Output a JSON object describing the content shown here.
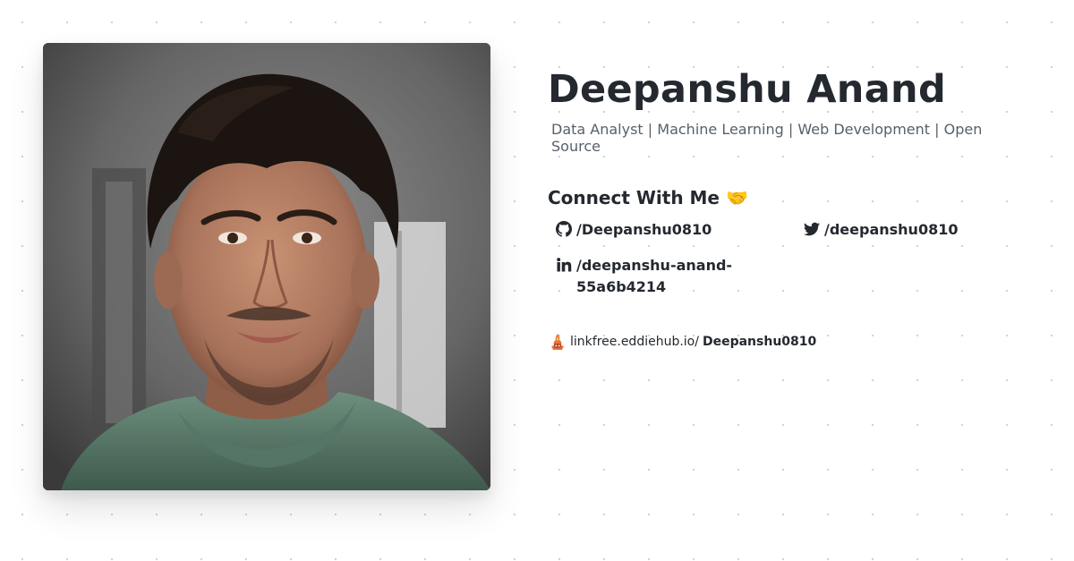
{
  "profile": {
    "name": "Deepanshu Anand",
    "tagline": "Data Analyst | Machine Learning | Web Development | Open Source",
    "connect_heading": "Connect With Me 🤝"
  },
  "socials": {
    "github": {
      "icon": "github-icon",
      "handle": "/Deepanshu0810"
    },
    "twitter": {
      "icon": "twitter-icon",
      "handle": "/deepanshu0810"
    },
    "linkedin": {
      "icon": "linkedin-icon",
      "handle": "/deepanshu-anand-55a6b4214"
    }
  },
  "linkfree": {
    "icon": "linkfree-logo-icon",
    "domain": "linkfree.eddiehub.io/",
    "username": "Deepanshu0810"
  },
  "colors": {
    "text": "#24292f",
    "muted": "#57606a",
    "background": "#ffffff",
    "dot_grid": "#cfcfcf"
  }
}
